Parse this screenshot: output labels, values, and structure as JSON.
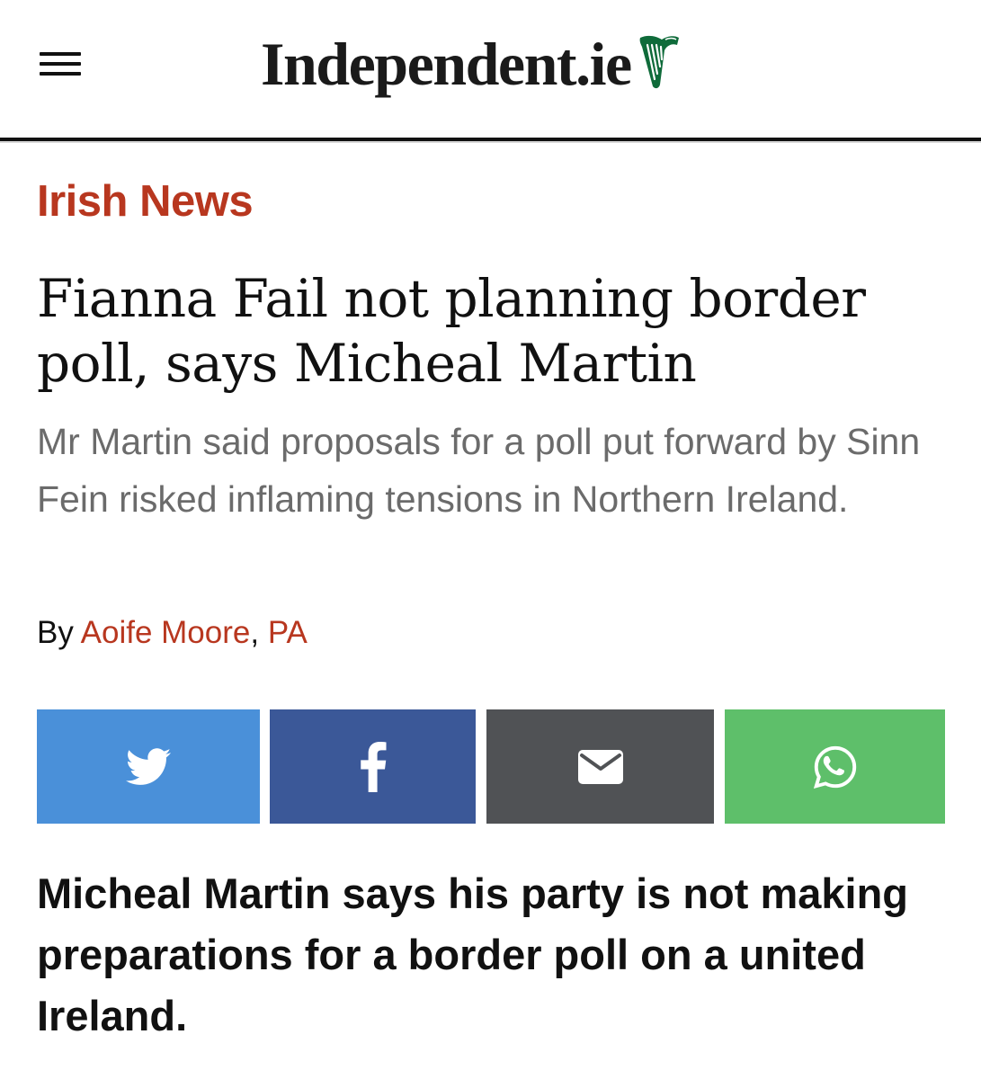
{
  "site": {
    "logo_text": "Independent.ie",
    "menu_icon": "hamburger-menu-icon",
    "brand_color": "#0f6b3a"
  },
  "article": {
    "section": "Irish News",
    "headline": "Fianna Fail not planning border poll, says Micheal Martin",
    "standfirst": "Mr Martin said proposals for a poll put forward by Sinn Fein risked inflaming tensions in Northern Ireland.",
    "byline": {
      "prefix": "By ",
      "author": "Aoife Moore",
      "separator": ", ",
      "agency": "PA"
    },
    "lede": "Micheal Martin says his party is not making preparations for a border poll on a united Ireland."
  },
  "share": [
    {
      "network": "twitter",
      "icon": "twitter-icon",
      "color": "#4a90d9"
    },
    {
      "network": "facebook",
      "icon": "facebook-icon",
      "color": "#3b5898"
    },
    {
      "network": "email",
      "icon": "email-icon",
      "color": "#505255"
    },
    {
      "network": "whatsapp",
      "icon": "whatsapp-icon",
      "color": "#5ebf6a"
    }
  ],
  "colors": {
    "section_accent": "#b8371f",
    "standfirst_text": "#6b6b6b"
  }
}
